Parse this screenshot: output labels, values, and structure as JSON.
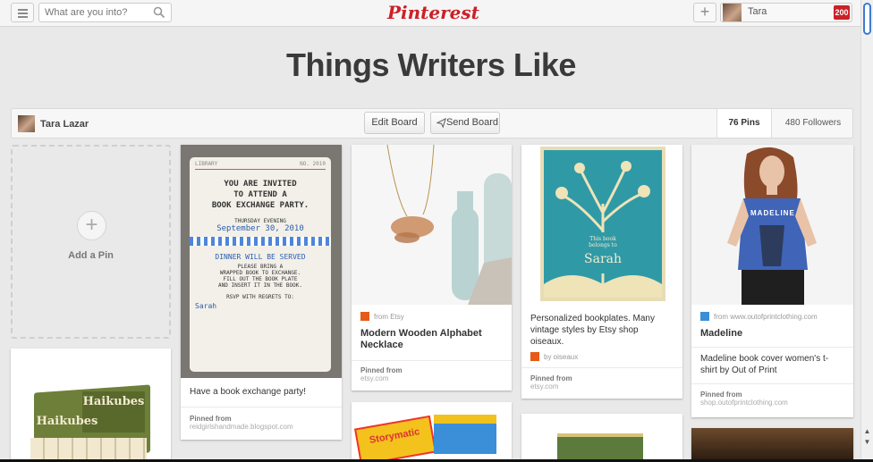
{
  "header": {
    "search_placeholder": "What are you into?",
    "logo_text": "Pinterest",
    "add_label": "+",
    "user_name": "Tara",
    "notification_count": "200"
  },
  "board": {
    "title": "Things Writers Like",
    "owner": "Tara Lazar",
    "edit_label": "Edit Board",
    "send_label": "Send Board",
    "pins_count": "76 Pins",
    "followers_count": "480 Followers"
  },
  "add_pin": {
    "label": "Add a Pin"
  },
  "pins": [
    {
      "image_text": [
        "LIBRARY",
        "NO. 2010",
        "YOU ARE INVITED",
        "TO ATTEND A",
        "BOOK EXCHANGE PARTY.",
        "THURSDAY EVENING",
        "September 30, 2010",
        "DINNER WILL BE SERVED",
        "PLEASE BRING A",
        "WRAPPED BOOK TO EXCHANGE.",
        "FILL OUT THE BOOK PLATE",
        "AND INSERT IT IN THE BOOK.",
        "RSVP WITH REGRETS TO:",
        "Sarah"
      ],
      "description": "Have a book exchange party!",
      "pinned_from_label": "Pinned from",
      "pinned_from": "reidgirlshandmade.blogspot.com"
    },
    {
      "source": "from Etsy",
      "title": "Modern Wooden Alphabet Necklace",
      "pinned_from_label": "Pinned from",
      "pinned_from": "etsy.com"
    },
    {
      "image_text": [
        "This book belongs to",
        "Sarah"
      ],
      "description": "Personalized bookplates. Many vintage styles by Etsy shop oiseaux.",
      "source": "by oiseaux",
      "pinned_from_label": "Pinned from",
      "pinned_from": "etsy.com"
    },
    {
      "image_text": "MADELINE",
      "source": "from www.outofprintclothing.com",
      "title": "Madeline",
      "description": "Madeline book cover women's t-shirt by Out of Print",
      "pinned_from_label": "Pinned from",
      "pinned_from": "shop.outofprintclothing.com"
    },
    {
      "image_text": [
        "Haikubes",
        "Haikubes"
      ]
    },
    {
      "image_text": "Storymatic"
    }
  ],
  "colors": {
    "brand": "#cb2027",
    "background": "#e9e9e9",
    "scroll_thumb": "#3b7bd4"
  }
}
